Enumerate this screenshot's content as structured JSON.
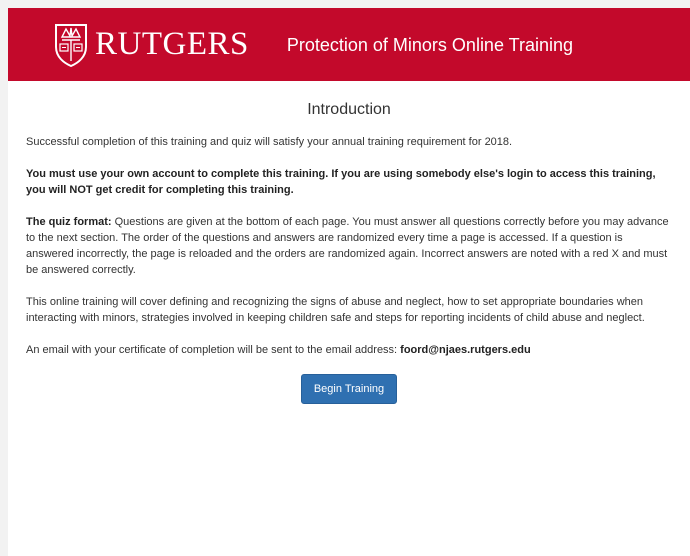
{
  "header": {
    "logo_text": "RUTGERS",
    "title": "Protection of Minors Online Training",
    "brand_color": "#c3092b"
  },
  "main": {
    "heading": "Introduction",
    "intro": "Successful completion of this training and quiz will satisfy your annual training requirement for 2018.",
    "account_warning": "You must use your own account to complete this training. If you are using somebody else's login to access this training, you will NOT get credit for completing this training.",
    "quiz_format_label": "The quiz format:",
    "quiz_format_text": " Questions are given at the bottom of each page. You must answer all questions correctly before you may advance to the next section. The order of the questions and answers are randomized every time a page is accessed. If a question is answered incorrectly, the page is reloaded and the orders are randomized again. Incorrect answers are noted with a red X and must be answered correctly.",
    "coverage": "This online training will cover defining and recognizing the signs of abuse and neglect, how to set appropriate boundaries when interacting with minors, strategies involved in keeping children safe and steps for reporting incidents of child abuse and neglect.",
    "email_text": "An email with your certificate of completion will be sent to the email address: ",
    "email_address": "foord@njaes.rutgers.edu",
    "begin_button": "Begin Training",
    "button_color": "#2f70b1"
  }
}
